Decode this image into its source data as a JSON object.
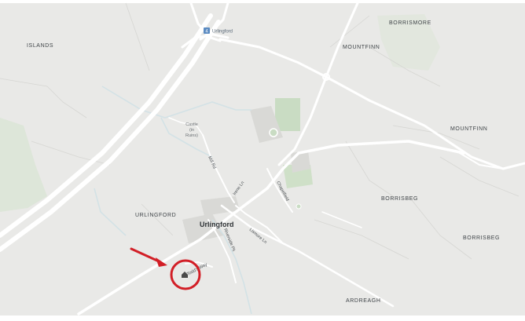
{
  "map": {
    "road_badge": "4",
    "road_badge_label": "Urlingford",
    "places": [
      {
        "key": "islands",
        "label": "ISLANDS"
      },
      {
        "key": "borrismore",
        "label": "BORRISMORE"
      },
      {
        "key": "mountfinn_n",
        "label": "MOUNTFINN"
      },
      {
        "key": "mountfinn_e",
        "label": "MOUNTFINN"
      },
      {
        "key": "borrisbeg_w",
        "label": "BORRISBEG"
      },
      {
        "key": "borrisbeg_e",
        "label": "BORRISBEG"
      },
      {
        "key": "urlingford_area",
        "label": "URLINGFORD"
      },
      {
        "key": "ardreagh",
        "label": "ARDREAGH"
      }
    ],
    "town": "Urlingford",
    "castle": [
      "Castle",
      "(in",
      "Ruins)"
    ],
    "streets": {
      "mill_rd": "Mill Rd",
      "irene_ln": "Irene Ln",
      "chapelfield": "Chapelfield",
      "riverside_pk": "Riverside Pk",
      "lismore_ln": "Lismore Ln",
      "todds_way": "Todd's Way"
    },
    "colors": {
      "land": "#e8e8e6",
      "road": "#ffffff",
      "water": "#cfe0e5",
      "park": "#c6dcc0",
      "marker": "#d21f27"
    }
  }
}
